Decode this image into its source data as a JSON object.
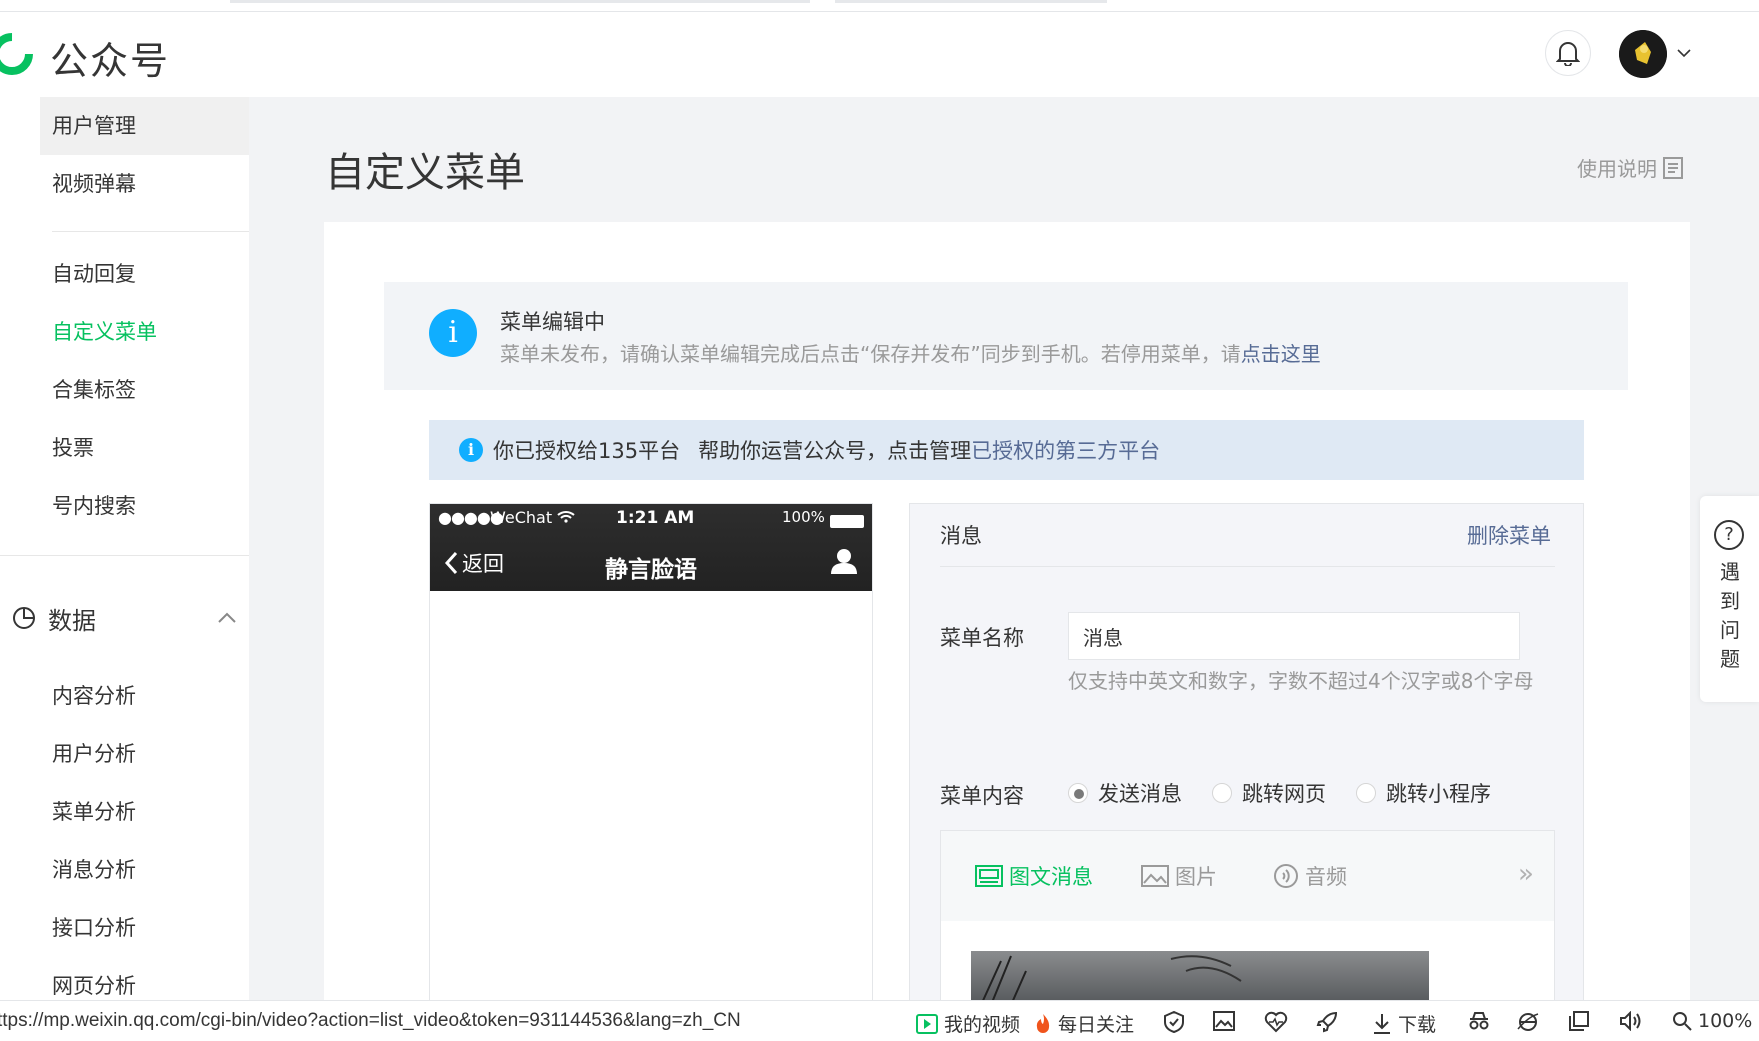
{
  "header": {
    "brand": "公众号"
  },
  "sidebar": {
    "items_top": [
      {
        "label": "用户管理"
      },
      {
        "label": "视频弹幕"
      }
    ],
    "items_mid": [
      {
        "label": "自动回复"
      },
      {
        "label": "自定义菜单"
      },
      {
        "label": "合集标签"
      },
      {
        "label": "投票"
      },
      {
        "label": "号内搜索"
      }
    ],
    "group_title": "数据",
    "items_data": [
      {
        "label": "内容分析"
      },
      {
        "label": "用户分析"
      },
      {
        "label": "菜单分析"
      },
      {
        "label": "消息分析"
      },
      {
        "label": "接口分析"
      },
      {
        "label": "网页分析"
      }
    ]
  },
  "main": {
    "page_title": "自定义菜单",
    "help_link": "使用说明",
    "notice": {
      "title": "菜单编辑中",
      "desc": "菜单未发布，请确认菜单编辑完成后点击“保存并发布”同步到手机。若停用菜单，请",
      "link": "点击这里"
    },
    "auth": {
      "text1": "你已授权给135平台",
      "text2": "帮助你运营公众号，点击管理",
      "link": "已授权的第三方平台"
    }
  },
  "phone": {
    "dots": "●●●●●",
    "carrier": "WeChat",
    "time": "1:21 AM",
    "battery": "100%",
    "back": "返回",
    "title": "静言脸语"
  },
  "editor": {
    "title": "消息",
    "delete": "删除菜单",
    "name_label": "菜单名称",
    "name_value": "消息",
    "hint": "仅支持中英文和数字，字数不超过4个汉字或8个字母",
    "content_label": "菜单内容",
    "radios": [
      {
        "label": "发送消息",
        "checked": true
      },
      {
        "label": "跳转网页",
        "checked": false
      },
      {
        "label": "跳转小程序",
        "checked": false
      }
    ],
    "tabs": [
      {
        "label": "图文消息",
        "icon": "news-icon",
        "active": true
      },
      {
        "label": "图片",
        "icon": "image-icon",
        "active": false
      },
      {
        "label": "音频",
        "icon": "audio-icon",
        "active": false
      }
    ],
    "more": "»"
  },
  "help_float": {
    "q": "?",
    "text": "遇到问题"
  },
  "statusbar": {
    "url": "ttps://mp.weixin.qq.com/cgi-bin/video?action=list_video&token=931144536&lang=zh_CN",
    "my_video": "我的视频",
    "daily": "每日关注",
    "download": "下载",
    "zoom": "100%"
  },
  "colors": {
    "accent": "#07c160",
    "link": "#576b95",
    "info": "#10aeff"
  }
}
